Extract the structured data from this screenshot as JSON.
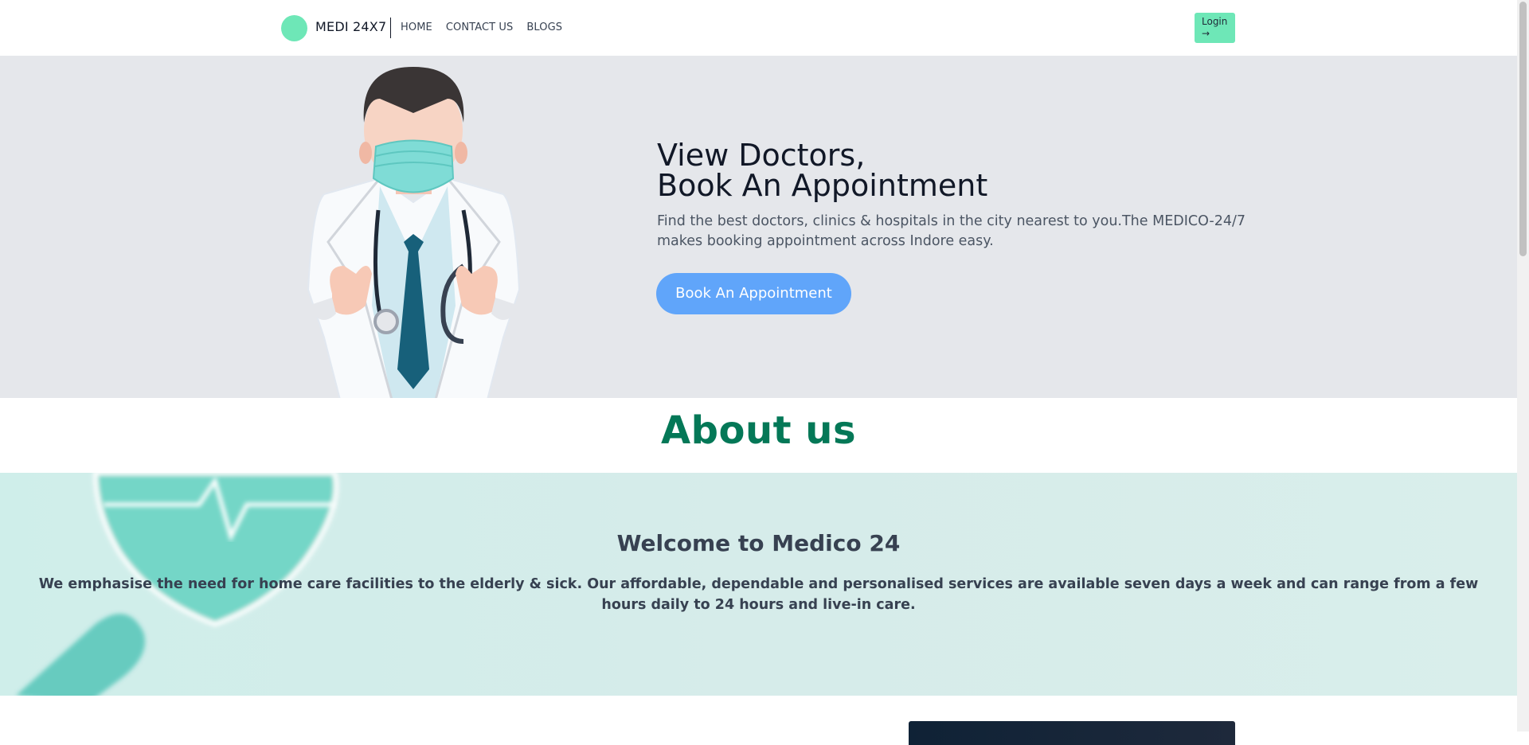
{
  "header": {
    "brand": "MEDI 24X7",
    "nav": [
      "HOME",
      "CONTACT US",
      "BLOGS"
    ],
    "login_label": "Login",
    "login_arrow": "→"
  },
  "hero": {
    "title_line1": "View Doctors,",
    "title_line2": "Book An Appointment",
    "description": "Find the best doctors, clinics & hospitals in the city nearest to you.The MEDICO-24/7 makes booking appointment across Indore easy.",
    "cta_label": "Book An Appointment"
  },
  "about": {
    "title": "About us",
    "welcome_title": "Welcome to Medico 24",
    "welcome_text": "We emphasise the need for home care facilities to the elderly & sick. Our affordable, dependable and personalised services are available seven days a week and can range from a few hours daily to 24 hours and live-in care."
  },
  "colors": {
    "accent": "#6ee7b7",
    "hero_bg": "#e5e7eb",
    "cta": "#60a5fa",
    "about_title": "#047857",
    "welcome_bg": "#d6ecea"
  },
  "icons": [
    "logo-circle",
    "arrow-right-icon",
    "doctor-illustration",
    "heart-pulse-illustration",
    "pill-illustration"
  ]
}
